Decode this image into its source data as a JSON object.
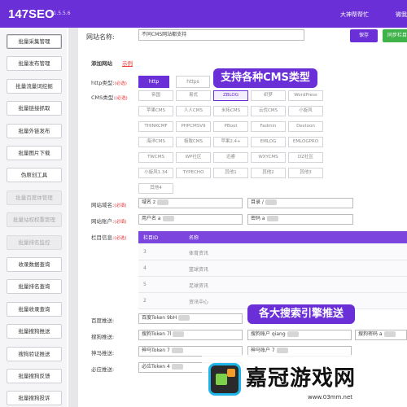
{
  "header": {
    "logo": "147SEO",
    "version": "v1.5.5.6",
    "help": "大神帮帮忙",
    "user": "微我"
  },
  "sidebar": {
    "items": [
      {
        "label": "批量采集管理",
        "state": "active"
      },
      {
        "label": "批量发布管理",
        "state": "normal"
      },
      {
        "label": "批量流量词挖掘",
        "state": "normal"
      },
      {
        "label": "批量链接抓取",
        "state": "normal"
      },
      {
        "label": "批量外链发布",
        "state": "normal"
      },
      {
        "label": "批量图片下载",
        "state": "normal"
      },
      {
        "label": "伪原创工具",
        "state": "normal"
      },
      {
        "label": "批量百度体管理",
        "state": "disabled"
      },
      {
        "label": "批量站权权重管理",
        "state": "disabled"
      },
      {
        "label": "批量排名监控",
        "state": "disabled"
      },
      {
        "label": "收录数据查询",
        "state": "normal"
      },
      {
        "label": "批量排名查询",
        "state": "normal"
      },
      {
        "label": "批量收录查询",
        "state": "normal"
      },
      {
        "label": "批量搜狗推送",
        "state": "normal"
      },
      {
        "label": "搜狗验证推送",
        "state": "normal"
      },
      {
        "label": "批量搜狗反馈",
        "state": "normal"
      },
      {
        "label": "批量搜狗投诉",
        "state": "normal"
      }
    ]
  },
  "site": {
    "name_label": "网站名称:",
    "name_value": "不同CMS网站都支持",
    "save_label": "保存",
    "sync_label": "同步栏目",
    "add_title": "添加网站",
    "example_link": "示例"
  },
  "http": {
    "label": "http类型:",
    "required": "(必选)",
    "options": [
      "http",
      "https"
    ],
    "selected": "http"
  },
  "cms": {
    "label": "CMS类型:",
    "required": "(必选)",
    "selected": "ZBLOG",
    "rows": [
      [
        "帝国",
        "易优",
        "ZBLOG",
        "织梦",
        "WordPress"
      ],
      [
        "苹果CMS",
        "人人CMS",
        "米拓CMS",
        "云优CMS",
        "小旋风"
      ],
      [
        "THINKCMF",
        "PHPCMSV9",
        "PBoot",
        "Fadmin",
        "Destoon"
      ],
      [
        "海洋CMS",
        "极致CMS",
        "苹果2.4+",
        "EMLOG",
        "EMLOGPRO"
      ],
      [
        "TWCMS",
        "WP社区",
        "迅睿",
        "WXYCMS",
        "DZ社区"
      ],
      [
        "小旋风1.34",
        "TYPECHO",
        "其他1",
        "其他2",
        "其他3"
      ],
      [
        "其他4"
      ]
    ]
  },
  "fields": {
    "domain_label": "网站域名:",
    "domain_required": "(必填)",
    "domain_value": "域名 z",
    "dir_value": "目录 /",
    "account_label": "网站账户:",
    "account_required": "(必填)",
    "username_value": "用户名 a",
    "password_value": "密码 a"
  },
  "columns": {
    "label": "栏目信息:",
    "required": "(必选)",
    "headers": [
      "栏目ID",
      "名称"
    ],
    "rows": [
      {
        "id": "3",
        "name": "体育资讯"
      },
      {
        "id": "4",
        "name": "篮球资讯"
      },
      {
        "id": "5",
        "name": "足球资讯"
      },
      {
        "id": "2",
        "name": "资讯中心"
      }
    ]
  },
  "push": {
    "baidu_label": "百度推送:",
    "baidu_value": "百度Token 9bH",
    "sogou_label": "搜狗推送:",
    "sogou_value1": "搜狗Token 7l",
    "sogou_value2": "搜狗账户 qiang",
    "sogou_value3": "搜狗密码 a",
    "shenma_label": "神马推送:",
    "shenma_value1": "神马Token 7",
    "shenma_value2": "神马账户 7",
    "bing_label": "必应推送:",
    "bing_value": "必应Token 4"
  },
  "callouts": {
    "cms": "支持各种CMS类型",
    "push": "各大搜索引擎推送"
  },
  "watermark": {
    "text": "嘉冠游戏网",
    "url": "www.03mm.net"
  },
  "colors": {
    "accent": "#6a2fd6",
    "save": "#6a2fd6",
    "sync": "#3fb24a"
  }
}
